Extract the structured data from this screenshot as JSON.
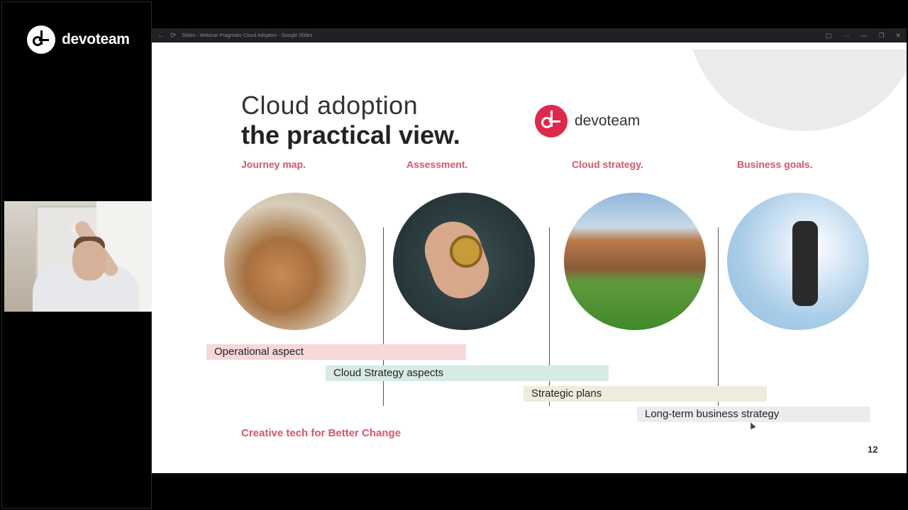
{
  "sidebar": {
    "logo_text": "devoteam"
  },
  "browser": {
    "tab_title": "Slides - Webinar Pragmatic Cloud Adoption - Google Slides"
  },
  "slide": {
    "title_light": "Cloud adoption",
    "title_bold": "the practical view.",
    "brand_text": "devoteam",
    "columns": [
      {
        "label": "Journey map."
      },
      {
        "label": "Assessment."
      },
      {
        "label": "Cloud strategy."
      },
      {
        "label": "Business goals."
      }
    ],
    "bars": [
      {
        "label": "Operational aspect",
        "color": "#f7d6dc"
      },
      {
        "label": "Cloud Strategy aspects",
        "color": "#d6ebe4"
      },
      {
        "label": "Strategic plans",
        "color": "#efebdd"
      },
      {
        "label": "Long-term business strategy",
        "color": "#ececec"
      }
    ],
    "tagline": "Creative tech for Better Change",
    "page_number": "12",
    "accent_color": "#d9546b",
    "brand_color": "#e0284b"
  }
}
